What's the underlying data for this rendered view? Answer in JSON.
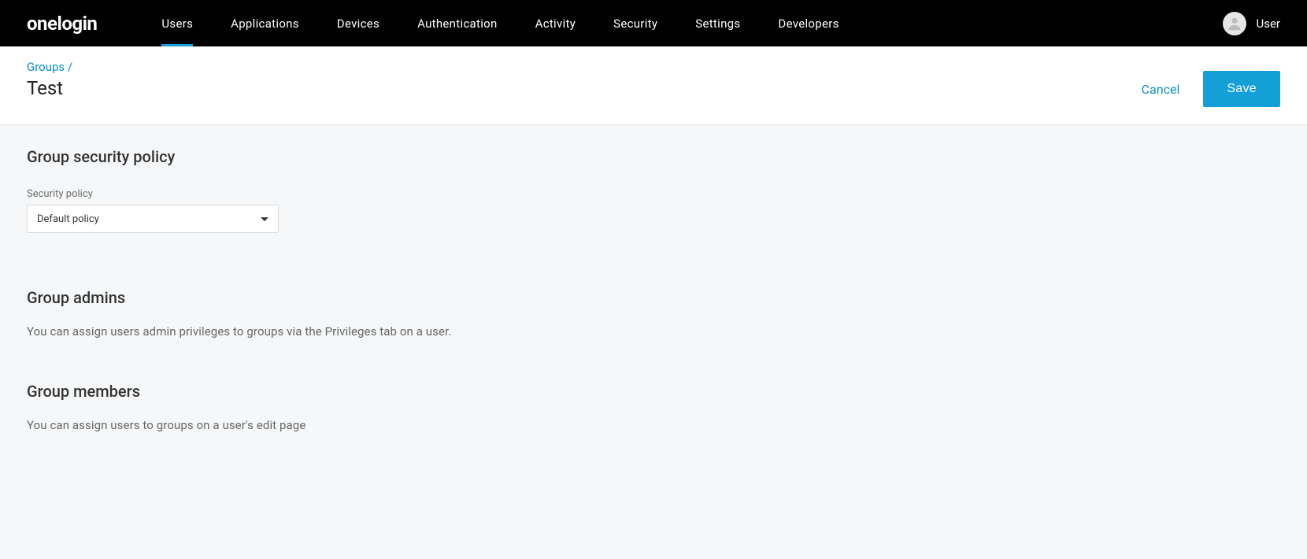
{
  "brand": "onelogin",
  "nav": {
    "items": [
      {
        "label": "Users",
        "active": true
      },
      {
        "label": "Applications"
      },
      {
        "label": "Devices"
      },
      {
        "label": "Authentication"
      },
      {
        "label": "Activity"
      },
      {
        "label": "Security"
      },
      {
        "label": "Settings"
      },
      {
        "label": "Developers"
      }
    ]
  },
  "user": {
    "name": "User"
  },
  "breadcrumb": {
    "parent": "Groups",
    "separator": "/"
  },
  "page": {
    "title": "Test"
  },
  "actions": {
    "cancel": "Cancel",
    "save": "Save"
  },
  "sections": {
    "policy": {
      "heading": "Group security policy",
      "field_label": "Security policy",
      "selected": "Default policy"
    },
    "admins": {
      "heading": "Group admins",
      "helper": "You can assign users admin privileges to groups via the Privileges tab on a user."
    },
    "members": {
      "heading": "Group members",
      "helper": "You can assign users to groups on a user's edit page"
    }
  }
}
